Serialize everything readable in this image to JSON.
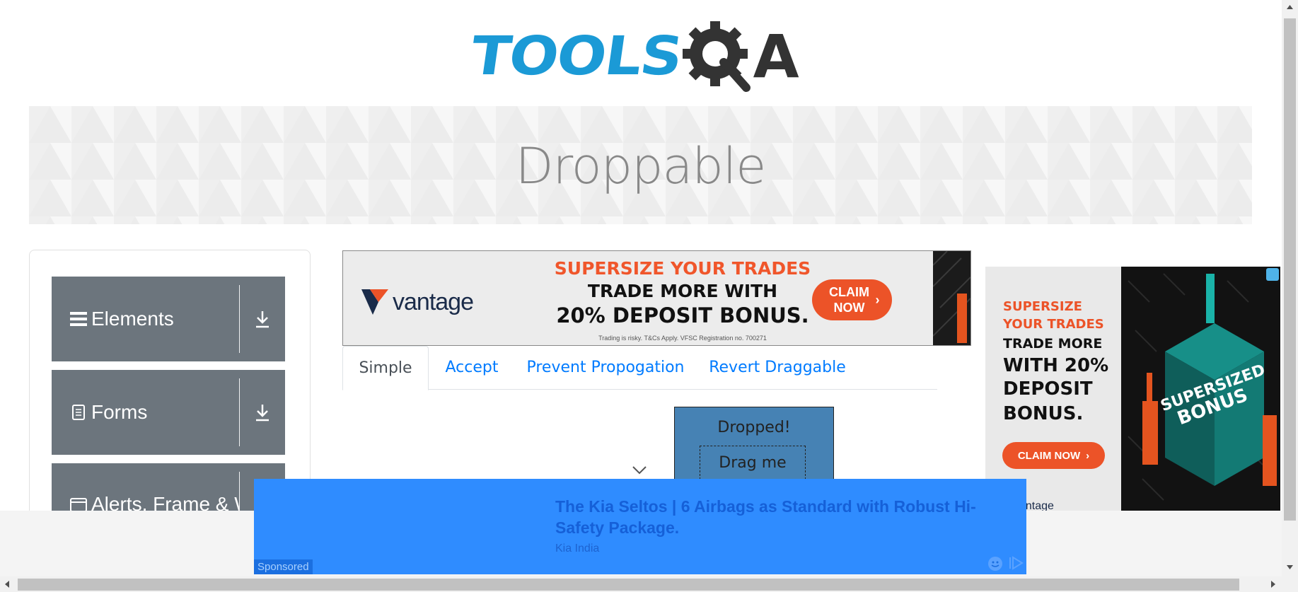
{
  "header": {
    "logo_tools": "TOOLS",
    "logo_a": "A"
  },
  "banner": {
    "title": "Droppable"
  },
  "sidebar": {
    "groups": [
      {
        "label": "Elements",
        "icon": "hamburger-icon"
      },
      {
        "label": "Forms",
        "icon": "document-icon"
      },
      {
        "label": "Alerts, Frame & Windows",
        "icon": "window-icon"
      }
    ]
  },
  "ad_top": {
    "brand": "vantage",
    "line1": "SUPERSIZE YOUR TRADES",
    "line2": "TRADE MORE WITH",
    "line3": "20% DEPOSIT BONUS.",
    "cta": "CLAIM NOW",
    "fine_print": "Trading is risky. T&Cs Apply. VFSC Registration no. 700271"
  },
  "ad_right": {
    "lines_orange": [
      "SUPERSIZE",
      "YOUR TRADES"
    ],
    "lines_black": [
      "TRADE MORE",
      "WITH 20%",
      "DEPOSIT",
      "BONUS."
    ],
    "cta": "CLAIM NOW",
    "graphic_text": [
      "SUPERSIZED",
      "BONUS"
    ],
    "brand_partial": "antage"
  },
  "tabs": [
    {
      "label": "Simple",
      "active": true
    },
    {
      "label": "Accept",
      "active": false
    },
    {
      "label": "Prevent Propogation",
      "active": false
    },
    {
      "label": "Revert Draggable",
      "active": false
    }
  ],
  "drag": {
    "drop_label": "Dropped!",
    "drag_label": "Drag me"
  },
  "sponsored": {
    "title": "The Kia Seltos | 6 Airbags as Standard with Robust Hi-Safety Package.",
    "advertiser": "Kia India",
    "tag": "Sponsored"
  },
  "colors": {
    "brand_blue": "#1b9ad6",
    "menu_gray": "#6c757d",
    "drop_blue": "#4682b4",
    "ad_orange": "#ec5328",
    "sponsor_blue": "#2f8cff",
    "link_blue": "#007bff"
  }
}
